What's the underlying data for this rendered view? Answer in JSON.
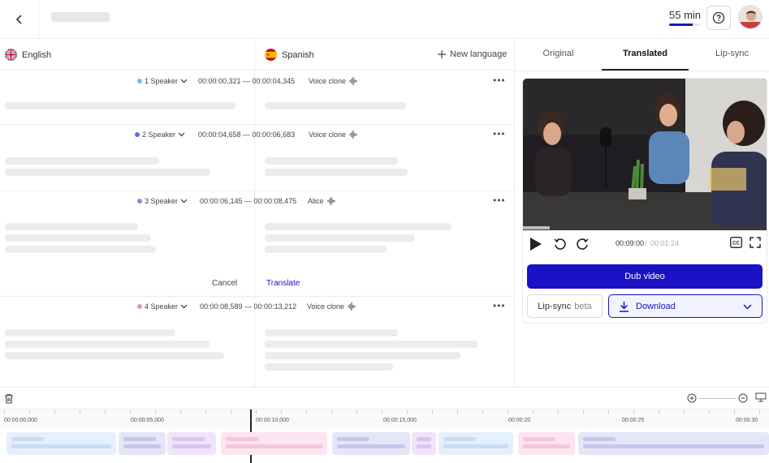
{
  "header": {
    "minutes_label": "55 min",
    "minutes_fraction": 0.75,
    "help_icon": "question-circle-icon",
    "back_icon": "chevron-left-icon"
  },
  "languages": {
    "source": "English",
    "target": "Spanish",
    "new_language": "New language"
  },
  "segments": [
    {
      "speaker": "1 Speaker",
      "color": "#7ab8f5",
      "timecode": "00:00:00,321 — 00:00:04,345",
      "voice": "Voice clone"
    },
    {
      "speaker": "2 Speaker",
      "color": "#5b6ee8",
      "timecode": "00:00:04,658 — 00:00:06,683",
      "voice": "Voice clone"
    },
    {
      "speaker": "3 Speaker",
      "color": "#a67ae8",
      "timecode": "00:00:06,145 — 00:00:08,475",
      "voice": "Alice"
    },
    {
      "speaker": "4 Speaker",
      "color": "#f088c8",
      "timecode": "00:00:08,589 — 00:00:13,212",
      "voice": "Voice clone"
    }
  ],
  "edit_actions": {
    "cancel": "Cancel",
    "translate": "Translate"
  },
  "tabs": [
    "Original",
    "Translated",
    "Lip-sync"
  ],
  "active_tab": "Translated",
  "player": {
    "current_time": "00:09:00",
    "total_time": "00:01:24",
    "progress_fraction": 0.11
  },
  "buttons": {
    "dub": "Dub video",
    "lipsync": "Lip-sync",
    "lipsync_badge": "beta",
    "download": "Download"
  },
  "timeline": {
    "ticks": [
      "00:00:00,000",
      "00:00:05,000",
      "00:00:10,000",
      "00:00:15,000",
      "00:00:20",
      "00:00:25",
      "00:00:30"
    ]
  },
  "colors": {
    "accent": "#1a12c4"
  }
}
